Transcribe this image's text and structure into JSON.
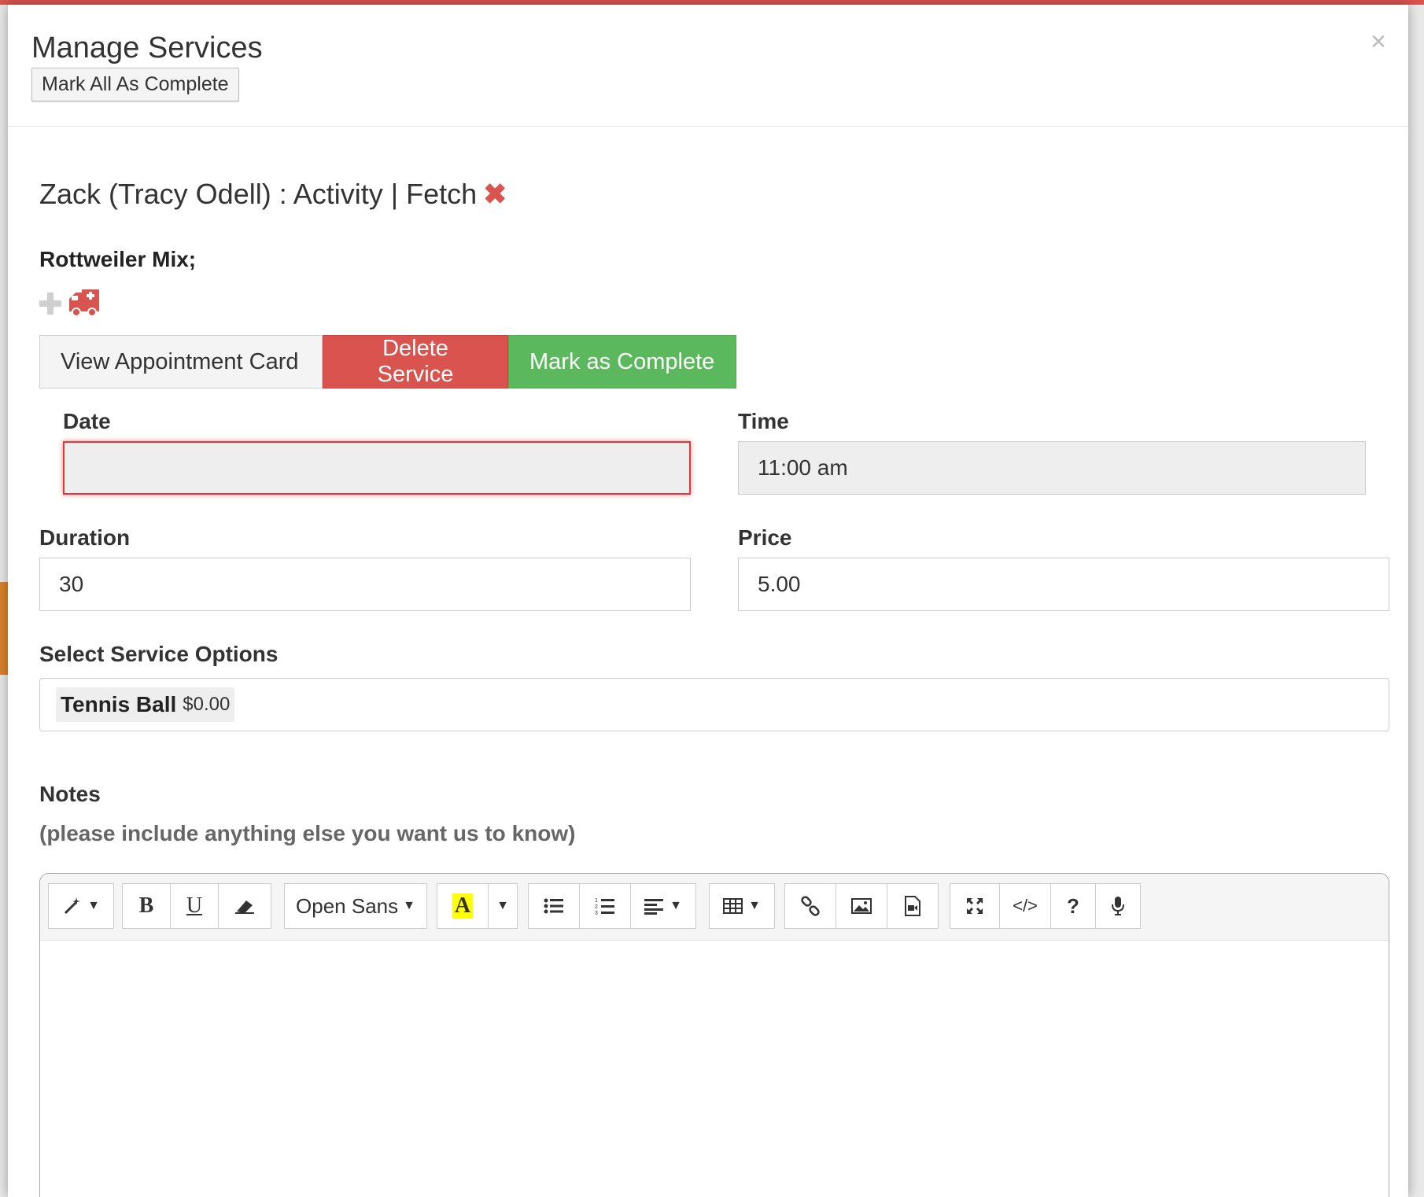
{
  "modal": {
    "title": "Manage Services",
    "mark_all_label": "Mark All As Complete",
    "close_glyph": "×"
  },
  "service": {
    "heading": "Zack (Tracy Odell) : Activity | Fetch",
    "remove_glyph": "✖",
    "breed": "Rottweiler Mix;",
    "icons": [
      "plus-icon",
      "ambulance-icon"
    ]
  },
  "actions": {
    "view_card": "View Appointment Card",
    "delete": "Delete Service",
    "complete": "Mark as Complete"
  },
  "form": {
    "date_label": "Date",
    "date_value": "",
    "time_label": "Time",
    "time_value": "11:00 am",
    "duration_label": "Duration",
    "duration_value": "30",
    "price_label": "Price",
    "price_value": "5.00",
    "options_label": "Select Service Options",
    "selected_option": {
      "name": "Tennis Ball",
      "price": "$0.00"
    }
  },
  "notes": {
    "label": "Notes",
    "sublabel": "(please include anything else you want us to know)",
    "font_name": "Open Sans",
    "bold_glyph": "B",
    "underline_glyph": "U",
    "color_glyph": "A",
    "help_glyph": "?",
    "code_glyph": "</>"
  },
  "colors": {
    "danger": "#d9534f",
    "success": "#5cb85c",
    "error_border": "#e03a3a"
  }
}
